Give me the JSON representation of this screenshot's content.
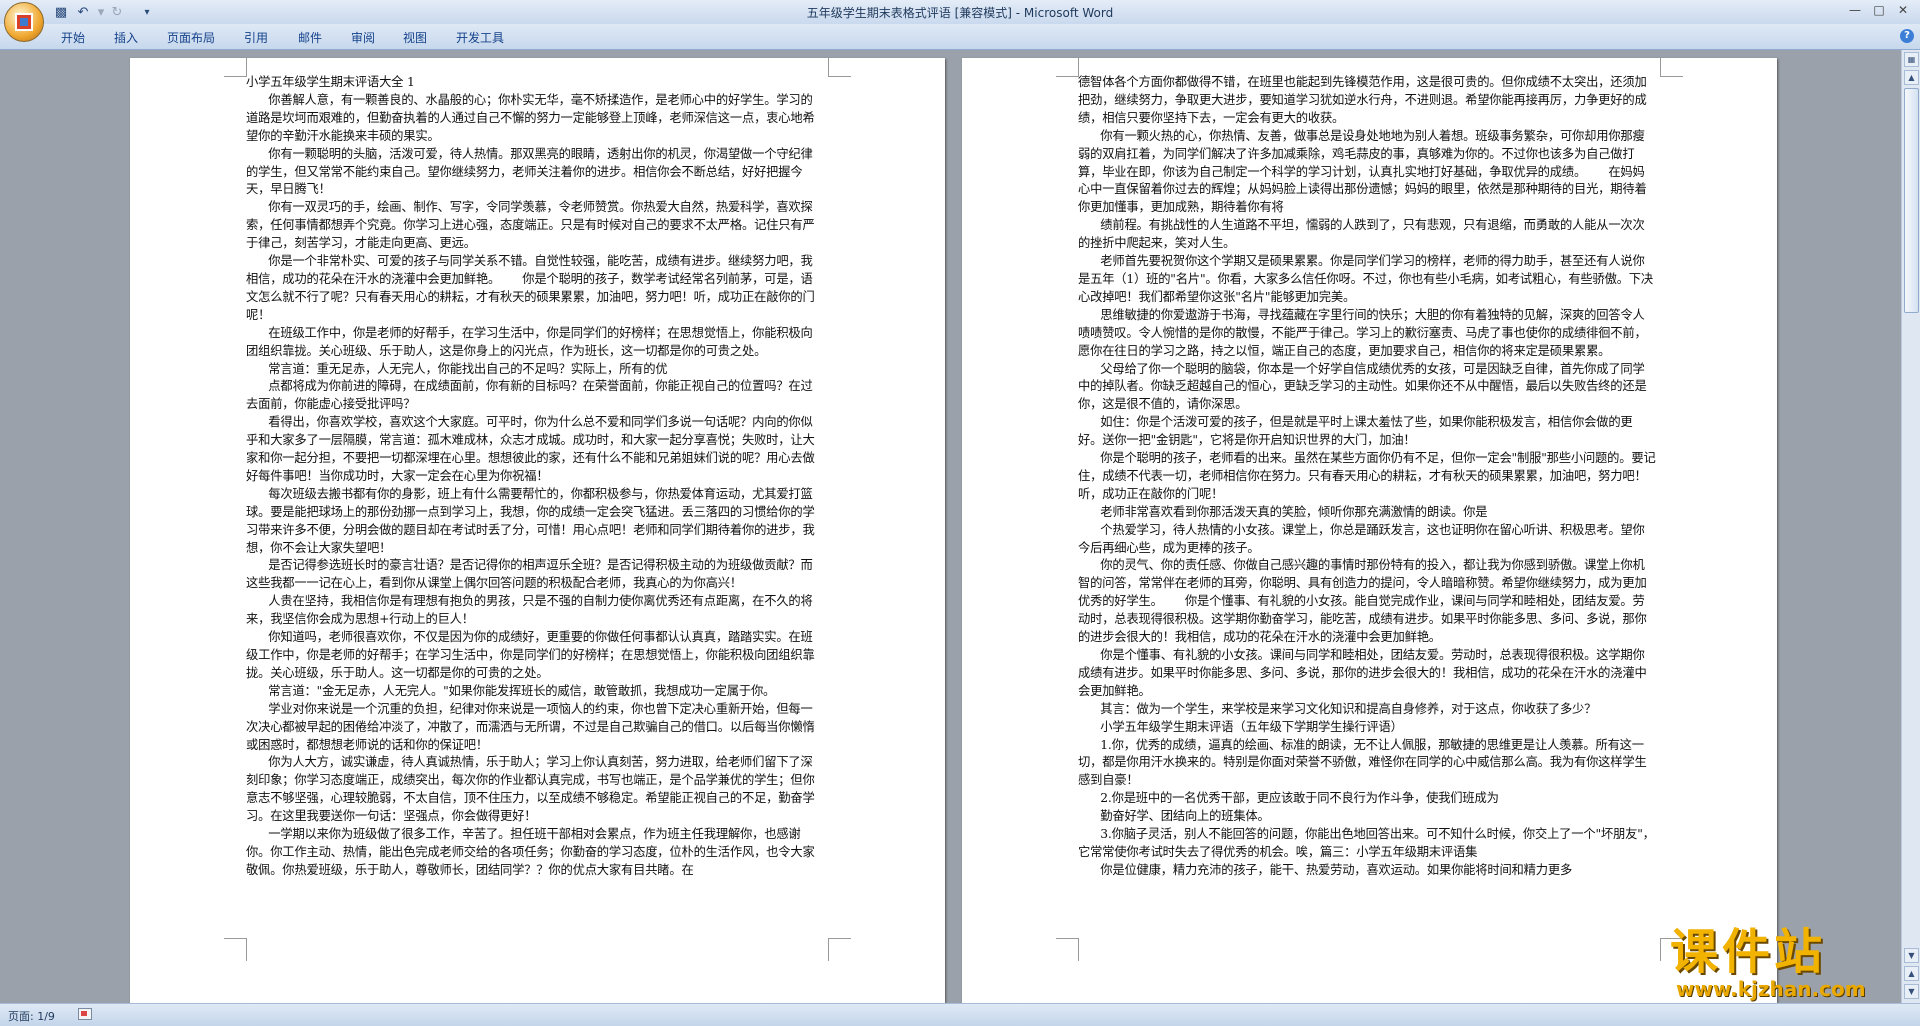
{
  "window": {
    "title": "五年级学生期末表格式评语 [兼容模式] - Microsoft Word"
  },
  "ribbon": {
    "tabs": [
      "开始",
      "插入",
      "页面布局",
      "引用",
      "邮件",
      "审阅",
      "视图",
      "开发工具"
    ]
  },
  "status": {
    "page": "页面: 1/9"
  },
  "watermark": {
    "cn": "课件站",
    "url": "www.kjzhan.com"
  },
  "document": {
    "page1": "小学五年级学生期末评语大全 1\n      你善解人意，有一颗善良的、水晶般的心；你朴实无华，毫不矫揉造作，是老师心中的好学生。学习的道路是坎坷而艰难的，但勤奋执着的人通过自己不懈的努力一定能够登上顶峰，老师深信这一点，衷心地希望你的辛勤汗水能换来丰硕的果实。\n      你有一颗聪明的头脑，活泼可爱，待人热情。那双黑亮的眼睛，透射出你的机灵，你渴望做一个守纪律的学生，但又常常不能约束自己。望你继续努力，老师关注着你的进步。相信你会不断总结，好好把握今天，早日腾飞！\n      你有一双灵巧的手，绘画、制作、写字，令同学羡慕，令老师赞赏。你热爱大自然，热爱科学，喜欢探索，任何事情都想弄个究竟。你学习上进心强，态度端正。只是有时候对自己的要求不太严格。记住只有严于律己，刻苦学习，才能走向更高、更远。\n      你是一个非常朴实、可爱的孩子与同学关系不错。自觉性较强，能吃苦，成绩有进步。继续努力吧，我相信，成功的花朵在汗水的浇灌中会更加鲜艳。      你是个聪明的孩子，数学考试经常名列前茅，可是，语文怎么就不行了呢？只有春天用心的耕耘，才有秋天的硕果累累，加油吧，努力吧！听，成功正在敲你的门呢！\n      在班级工作中，你是老师的好帮手，在学习生活中，你是同学们的好榜样；在思想觉悟上，你能积极向团组织靠拢。关心班级、乐于助人，这是你身上的闪光点，作为班长，这一切都是你的可贵之处。\n      常言道：重无足赤，人无完人，你能找出自己的不足吗？实际上，所有的优\n      点都将成为你前进的障碍，在成绩面前，你有新的目标吗？在荣誉面前，你能正视自己的位置吗？在过去面前，你能虚心接受批评吗？\n      看得出，你喜欢学校，喜欢这个大家庭。可平时，你为什么总不爱和同学们多说一句话呢？内向的你似乎和大家多了一层隔膜，常言道：孤木难成林，众志才成城。成功时，和大家一起分享喜悦；失败时，让大家和你一起分担，不要把一切都深埋在心里。想想彼此的家，还有什么不能和兄弟姐妹们说的呢？用心去做好每件事吧！当你成功时，大家一定会在心里为你祝福！\n      每次班级去搬书都有你的身影，班上有什么需要帮忙的，你都积极参与，你热爱体育运动，尤其爱打篮球。要是能把球场上的那份劲挪一点到学习上，我想，你的成绩一定会突飞猛进。丢三落四的习惯给你的学习带来许多不便，分明会做的题目却在考试时丢了分，可惜！用心点吧！老师和同学们期待着你的进步，我想，你不会让大家失望吧！\n      是否记得参选班长时的豪言壮语？是否记得你的相声逗乐全班？是否记得积极主动的为班级做贡献？而这些我都一一记在心上，看到你从课堂上偶尔回答问题的积极配合老师，我真心的为你高兴！\n      人贵在坚持，我相信你是有理想有抱负的男孩，只是不强的自制力使你离优秀还有点距离，在不久的将来，我坚信你会成为思想+行动上的巨人！\n      你知道吗，老师很喜欢你，不仅是因为你的成绩好，更重要的你做任何事都认认真真，踏踏实实。在班级工作中，你是老师的好帮手；在学习生活中，你是同学们的好榜样；在思想觉悟上，你能积极向团组织靠拢。关心班级，乐于助人。这一切都是你的可贵的之处。\n      常言道：\"金无足赤，人无完人。\"如果你能发挥班长的威信，敢管敢抓，我想成功一定属于你。\n      学业对你来说是一个沉重的负担，纪律对你来说是一项恼人的约束，你也曾下定决心重新开始，但每一次决心都被早起的困倦给冲淡了，冲散了，而濡洒与无所谓，不过是自己欺骗自己的借口。以后每当你懒惰或困惑时，都想想老师说的话和你的保证吧！\n      你为人大方，诚实谦虚，待人真诚热情，乐于助人；学习上你认真刻苦，努力进取，给老师们留下了深刻印象；你学习态度端正，成绩突出，每次你的作业都认真完成，书写也端正，是个品学兼优的学生；但你意志不够坚强，心理较脆弱，不太自信，顶不住压力，以至成绩不够稳定。希望能正视自己的不足，勤奋学习。在这里我要送你一句话：坚强点，你会做得更好！\n      一学期以来你为班级做了很多工作，辛苦了。担任班干部相对会累点，作为班主任我理解你，也感谢你。你工作主动、热情，能出色完成老师交给的各项任务；你勤奋的学习态度，位朴的生活作风，也令大家敬佩。你热爱班级，乐于助人，尊敬师长，团结同学？？你的优点大家有目共睹。在",
    "page2": "德智体各个方面你都做得不错，在班里也能起到先锋模范作用，这是很可贵的。但你成绩不太突出，还须加把劲，继续努力，争取更大进步，要知道学习犹如逆水行舟，不进则退。希望你能再接再厉，力争更好的成绩，相信只要你坚持下去，一定会有更大的收获。\n      你有一颗火热的心，你热情、友善，做事总是设身处地地为别人着想。班级事务繁杂，可你却用你那瘦弱的双肩扛着，为同学们解决了许多加减乘除，鸡毛蒜皮的事，真够难为你的。不过你也该多为自己做打算，毕业在即，你该为自己制定一个科学的学习计划，认真扎实地打好基础，争取优异的成绩。      在妈妈心中一直保留着你过去的辉煌；从妈妈脸上读得出那份遗憾；妈妈的眼里，依然是那种期待的目光，期待着你更加懂事，更加成熟，期待着你有将\n      绩前程。有挑战性的人生道路不平坦，懦弱的人跌到了，只有悲观，只有退缩，而勇敢的人能从一次次的挫折中爬起来，笑对人生。\n      老师首先要祝贺你这个学期又是硕果累累。你是同学们学习的榜样，老师的得力助手，甚至还有人说你是五年（1）班的\"名片\"。你看，大家多么信任你呀。不过，你也有些小毛病，如考试粗心，有些骄傲。下决心改掉吧！我们都希望你这张\"名片\"能够更加完美。\n      思维敏捷的你爱遨游于书海，寻找蕴藏在字里行间的快乐；大胆的你有着独特的见解，深爽的回答令人啧啧赞叹。令人惋惜的是你的散慢，不能严于律己。学习上的歉衍塞责、马虎了事也使你的成绩徘徊不前，愿你在往日的学习之路，持之以恒，端正自己的态度，更加要求自己，相信你的将来定是硕果累累。\n      父母给了你一个聪明的脑袋，你本是一个好学自信成绩优秀的女孩，可是因缺乏自律，首先你成了同学中的掉队者。你缺乏超越自己的恒心，更缺乏学习的主动性。如果你还不从中醒悟，最后以失败告终的还是你，这是很不值的，请你深思。\n      如住：你是个活泼可爱的孩子，但是就是平时上课太羞怯了些，如果你能积极发言，相信你会做的更好。送你一把\"金钥匙\"，它将是你开启知识世界的大门，加油！\n      你是个聪明的孩子，老师看的出来。虽然在某些方面你仍有不足，但你一定会\"制服\"那些小问题的。要记住，成绩不代表一切，老师相信你在努力。只有春天用心的耕耘，才有秋天的硕果累累，加油吧，努力吧！听，成功正在敲你的门呢！\n      老师非常喜欢看到你那活泼天真的笑脸，倾听你那充满激情的朗读。你是\n      个热爱学习，待人热情的小女孩。课堂上，你总是踊跃发言，这也证明你在留心听讲、积极思考。望你今后再细心些，成为更棒的孩子。\n      你的灵气、你的责任感、你做自己感兴趣的事情时那份特有的投入，都让我为你感到骄傲。课堂上你机智的问答，常常伴在老师的耳旁，你聪明、具有创造力的提问，令人暗暗称赞。希望你继续努力，成为更加优秀的好学生。      你是个懂事、有礼貌的小女孩。能自觉完成作业，课间与同学和睦相处，团结友爱。劳动时，总表现得很积极。这学期你勤奋学习，能吃苦，成绩有进步。如果平时你能多思、多问、多说，那你的进步会很大的！我相信，成功的花朵在汗水的浇灌中会更加鲜艳。\n      你是个懂事、有礼貌的小女孩。课间与同学和睦相处，团结友爱。劳动时，总表现得很积极。这学期你成绩有进步。如果平时你能多思、多问、多说，那你的进步会很大的！我相信，成功的花朵在汗水的浇灌中会更加鲜艳。\n      其言：做为一个学生，来学校是来学习文化知识和提高自身修养，对于这点，你收获了多少？\n      小学五年级学生期末评语（五年级下学期学生操行评语）\n      1.你，优秀的成绩，逼真的绘画、标准的朗读，无不让人佩服，那敏捷的思维更是让人羡慕。所有这一切，都是你用汗水换来的。特别是你面对荣誉不骄傲，难怪你在同学的心中威信那么高。我为有你这样学生感到自豪！\n      2.你是班中的一名优秀干部，更应该敢于同不良行为作斗争，使我们班成为\n      勤奋好学、团结向上的班集体。\n      3.你脑子灵活，别人不能回答的问题，你能出色地回答出来。可不知什么时候，你交上了一个\"坏朋友\"，它常常使你考试时失去了得优秀的机会。唉，篇三：小学五年级期末评语集\n      你是位健康，精力充沛的孩子，能干、热爱劳动，喜欢运动。如果你能将时间和精力更多"
  }
}
